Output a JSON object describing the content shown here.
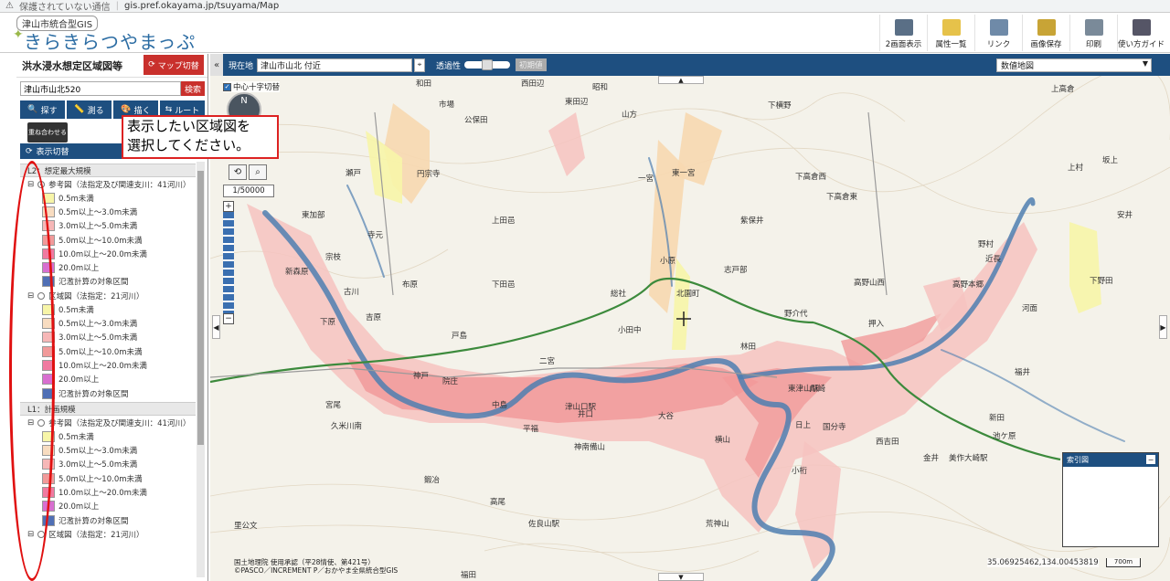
{
  "browser": {
    "security_warning": "保護されていない通信",
    "url": "gis.pref.okayama.jp/tsuyama/Map"
  },
  "header": {
    "system_name": "津山市統合型GIS",
    "app_title": "きらきらつやまっぷ",
    "toolbar": [
      {
        "label": "2画面表示",
        "icon": "split-screen-icon"
      },
      {
        "label": "属性一覧",
        "icon": "attribute-list-icon"
      },
      {
        "label": "リンク",
        "icon": "link-icon"
      },
      {
        "label": "画像保存",
        "icon": "save-image-icon"
      },
      {
        "label": "印刷",
        "icon": "print-icon"
      },
      {
        "label": "使い方ガイド",
        "icon": "guide-icon"
      }
    ]
  },
  "left_panel": {
    "title": "洪水浸水想定区域図等",
    "map_switch_label": "マップ切替",
    "search_value": "津山市山北520",
    "search_button": "検索",
    "actions": [
      "探す",
      "測る",
      "描く",
      "ルート"
    ],
    "overlay_label": "重ね合わせる",
    "display_switch_label": "表示切替",
    "callout_text_line1": "表示したい区域図を",
    "callout_text_line2": "選択してください。",
    "groups": [
      {
        "group_label": "L2：想定最大規模",
        "subs": [
          {
            "label": "参考図（法指定及び関連支川：41河川）",
            "selected": true,
            "items": [
              {
                "label": "0.5m未満",
                "color": "#f7f5a8"
              },
              {
                "label": "0.5m以上～3.0m未満",
                "color": "#f8dcc0"
              },
              {
                "label": "3.0m以上～5.0m未満",
                "color": "#f6b7b7"
              },
              {
                "label": "5.0m以上～10.0m未満",
                "color": "#f19a9a"
              },
              {
                "label": "10.0m以上～20.0m未満",
                "color": "#f07aa0"
              },
              {
                "label": "20.0m以上",
                "color": "#d86fd0"
              },
              {
                "label": "氾濫計算の対象区間",
                "color": "#4f6fb5"
              }
            ]
          },
          {
            "label": "区域図（法指定：21河川）",
            "selected": false,
            "items": [
              {
                "label": "0.5m未満",
                "color": "#f7f5a8"
              },
              {
                "label": "0.5m以上～3.0m未満",
                "color": "#f8dcc0"
              },
              {
                "label": "3.0m以上～5.0m未満",
                "color": "#f6b7b7"
              },
              {
                "label": "5.0m以上～10.0m未満",
                "color": "#f19a9a"
              },
              {
                "label": "10.0m以上～20.0m未満",
                "color": "#f07aa0"
              },
              {
                "label": "20.0m以上",
                "color": "#d86fd0"
              },
              {
                "label": "氾濫計算の対象区間",
                "color": "#4f6fb5"
              }
            ]
          }
        ]
      },
      {
        "group_label": "L1：計画規模",
        "subs": [
          {
            "label": "参考図（法指定及び関連支川：41河川）",
            "selected": false,
            "items": [
              {
                "label": "0.5m未満",
                "color": "#f7f5a8"
              },
              {
                "label": "0.5m以上～3.0m未満",
                "color": "#f8dcc0"
              },
              {
                "label": "3.0m以上～5.0m未満",
                "color": "#f6b7b7"
              },
              {
                "label": "5.0m以上～10.0m未満",
                "color": "#f19a9a"
              },
              {
                "label": "10.0m以上～20.0m未満",
                "color": "#f07aa0"
              },
              {
                "label": "20.0m以上",
                "color": "#d86fd0"
              },
              {
                "label": "氾濫計算の対象区間",
                "color": "#4f6fb5"
              }
            ]
          },
          {
            "label": "区域図（法指定：21河川）",
            "selected": false,
            "items": []
          }
        ]
      }
    ]
  },
  "map": {
    "location_label": "現在地",
    "location_value": "津山市山北 付近",
    "transparency_label": "透過性",
    "transparency_percent": 50,
    "init_button": "初期値",
    "basemap_value": "数値地図",
    "crosshair_label": "中心十字切替",
    "compass_label": "N",
    "scale_value": "1/50000",
    "index_map_label": "索引図",
    "coordinates": "35.06925462,134.00453819",
    "scale_bar_label": "700m",
    "copyright_line1": "国土地理院 使用承認（平28情使、第421号）",
    "copyright_line2": "©PASCO／INCREMENT P／おかやま全県統合型GIS",
    "place_labels": [
      {
        "text": "和田",
        "name": "wada"
      },
      {
        "text": "西田辺",
        "name": "nishitanabe"
      },
      {
        "text": "東田辺",
        "name": "higashitanabe"
      },
      {
        "text": "昭和",
        "name": "showa"
      },
      {
        "text": "市場",
        "name": "ichiba"
      },
      {
        "text": "公保田",
        "name": "kubota"
      },
      {
        "text": "山方",
        "name": "yamagata"
      },
      {
        "text": "下横野",
        "name": "shimoyokono"
      },
      {
        "text": "上高倉",
        "name": "kamitakakura"
      },
      {
        "text": "円宗寺",
        "name": "ensyuji"
      },
      {
        "text": "一宮",
        "name": "ichinomiya"
      },
      {
        "text": "東一宮",
        "name": "higashiichinomiya"
      },
      {
        "text": "下高倉西",
        "name": "shimotakakuranishi"
      },
      {
        "text": "下高倉東",
        "name": "shimotakakurahigashi"
      },
      {
        "text": "瀬戸",
        "name": "seto"
      },
      {
        "text": "寺元",
        "name": "teramoto"
      },
      {
        "text": "東加部",
        "name": "higashikabe"
      },
      {
        "text": "上田邑",
        "name": "kamitaminowa"
      },
      {
        "text": "紫保井",
        "name": "shiboi"
      },
      {
        "text": "新森原",
        "name": "shinmorihara"
      },
      {
        "text": "宗枝",
        "name": "muneeda"
      },
      {
        "text": "布原",
        "name": "nunohara"
      },
      {
        "text": "下田邑",
        "name": "shimotaminowa"
      },
      {
        "text": "小原",
        "name": "ohara"
      },
      {
        "text": "志戸部",
        "name": "shitobe"
      },
      {
        "text": "北園町",
        "name": "kitazonocho"
      },
      {
        "text": "古川",
        "name": "furukawa"
      },
      {
        "text": "吉原",
        "name": "yoshihara"
      },
      {
        "text": "下原",
        "name": "shimohara"
      },
      {
        "text": "総社",
        "name": "sosya"
      },
      {
        "text": "野介代",
        "name": "nokeshiro"
      },
      {
        "text": "高野山西",
        "name": "takanoyamanishi"
      },
      {
        "text": "高野本郷",
        "name": "takanohongo"
      },
      {
        "text": "押入",
        "name": "oshiire"
      },
      {
        "text": "戸島",
        "name": "toshima"
      },
      {
        "text": "小田中",
        "name": "odanaka"
      },
      {
        "text": "林田",
        "name": "hayashida"
      },
      {
        "text": "院庄",
        "name": "innosho"
      },
      {
        "text": "神戸",
        "name": "jinde"
      },
      {
        "text": "二宮",
        "name": "ninomiya"
      },
      {
        "text": "中島",
        "name": "nakashima"
      },
      {
        "text": "津山口駅",
        "name": "tsuyamaguchi"
      },
      {
        "text": "大谷",
        "name": "otani"
      },
      {
        "text": "川崎",
        "name": "kawasaki"
      },
      {
        "text": "東津山駅",
        "name": "higashitsuyama"
      },
      {
        "text": "宮尾",
        "name": "miyao"
      },
      {
        "text": "久米川南",
        "name": "kumegawaminami"
      },
      {
        "text": "平福",
        "name": "hirafuku"
      },
      {
        "text": "井口",
        "name": "iguchi"
      },
      {
        "text": "日上",
        "name": "hikami"
      },
      {
        "text": "国分寺",
        "name": "kokubunji"
      },
      {
        "text": "神南備山",
        "name": "kannabiyama"
      },
      {
        "text": "横山",
        "name": "yokoyama"
      },
      {
        "text": "小桁",
        "name": "kogeta"
      },
      {
        "text": "西吉田",
        "name": "nishiyoshida"
      },
      {
        "text": "金井",
        "name": "kanai"
      },
      {
        "text": "美作大崎駅",
        "name": "mimasakaosaki"
      },
      {
        "text": "鍛冶",
        "name": "kaji"
      },
      {
        "text": "高尾",
        "name": "takao"
      },
      {
        "text": "佐良山駅",
        "name": "sarayama"
      },
      {
        "text": "荒神山",
        "name": "kojinyama"
      },
      {
        "text": "里公文",
        "name": "satokumon"
      },
      {
        "text": "福田",
        "name": "fukuda"
      },
      {
        "text": "近長",
        "name": "chikanaga"
      },
      {
        "text": "河面",
        "name": "kawamo"
      },
      {
        "text": "福井",
        "name": "fukui"
      },
      {
        "text": "池ケ原",
        "name": "ikegahara"
      },
      {
        "text": "新田",
        "name": "shinden"
      },
      {
        "text": "下野田",
        "name": "shimonoda"
      },
      {
        "text": "野村",
        "name": "nomura"
      },
      {
        "text": "上村",
        "name": "kamimura"
      },
      {
        "text": "安井",
        "name": "yasui"
      },
      {
        "text": "坂上",
        "name": "sakaue"
      }
    ]
  }
}
